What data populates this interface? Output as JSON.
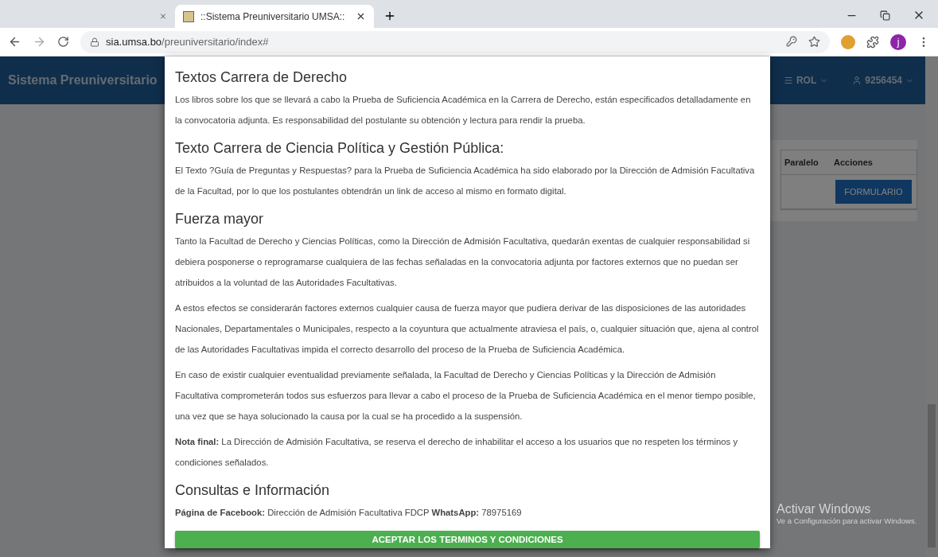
{
  "browser": {
    "tabs": [
      {
        "selected": false
      },
      {
        "title": "::Sistema Preuniversitario UMSA::",
        "selected": true
      }
    ],
    "url_host": "sia.umsa.bo",
    "url_path": "/preuniversitario/index#",
    "profile_initial": "j"
  },
  "navbar": {
    "brand": "Sistema Preuniversitario",
    "menus": [
      {
        "kind": "menu",
        "label": "ROL"
      },
      {
        "kind": "user",
        "label": "9256454"
      }
    ]
  },
  "table": {
    "columns": [
      "Paralelo",
      "Acciones"
    ],
    "rows": [
      {
        "action": "FORMULARIO"
      }
    ]
  },
  "modal": {
    "sections": [
      {
        "heading": "Textos Carrera de Derecho",
        "paragraphs": [
          "Los libros sobre los que se llevará a cabo la Prueba de Suficiencia Académica en la Carrera de Derecho, están especificados detalladamente en la convocatoria adjunta. Es responsabilidad del postulante su obtención y lectura para rendir la prueba."
        ]
      },
      {
        "heading": "Texto Carrera de Ciencia Política y Gestión Pública:",
        "paragraphs": [
          "El Texto ?Guía de Preguntas y Respuestas? para la Prueba de Suficiencia Académica ha sido elaborado por la Dirección de Admisión Facultativa de la Facultad, por lo que los postulantes obtendrán un link de acceso al mismo en formato digital."
        ]
      },
      {
        "heading": "Fuerza mayor",
        "paragraphs": [
          "Tanto la Facultad de Derecho y Ciencias Políticas, como la Dirección de Admisión Facultativa, quedarán exentas de cualquier responsabilidad si debiera posponerse o reprogramarse cualquiera de las fechas señaladas en la convocatoria adjunta por factores externos que no puedan ser atribuidos a la voluntad de las Autoridades Facultativas.",
          "A estos efectos se considerarán factores externos cualquier causa de fuerza mayor que pudiera derivar de las disposiciones de las autoridades Nacionales, Departamentales o Municipales, respecto a la coyuntura que actualmente atraviesa el país, o, cualquier situación que, ajena al control de las Autoridades Facultativas impida el correcto desarrollo del proceso de la Prueba de Suficiencia Académica.",
          "En caso de existir cualquier eventualidad previamente señalada, la Facultad de Derecho y Ciencias Políticas y la Dirección de Admisión Facultativa comprometerán todos sus esfuerzos para llevar a cabo el proceso de la Prueba de Suficiencia Académica en el menor tiempo posible, una vez que se haya solucionado la causa por la cual se ha procedido a la suspensión.",
          "**Nota final:** La Dirección de Admisión Facultativa, se reserva el derecho de inhabilitar el acceso a los usuarios que no respeten los términos y condiciones señalados."
        ]
      },
      {
        "heading": "Consultas e Información",
        "paragraphs": [
          "**Página de Facebook:** Dirección de Admisión Facultativa FDCP **WhatsApp:** 78975169"
        ]
      }
    ],
    "accept_button": "ACEPTAR LOS TERMINOS Y CONDICIONES"
  },
  "windows_notice": {
    "title": "Activar Windows",
    "text": "Ve a Configuración para activar Windows."
  }
}
